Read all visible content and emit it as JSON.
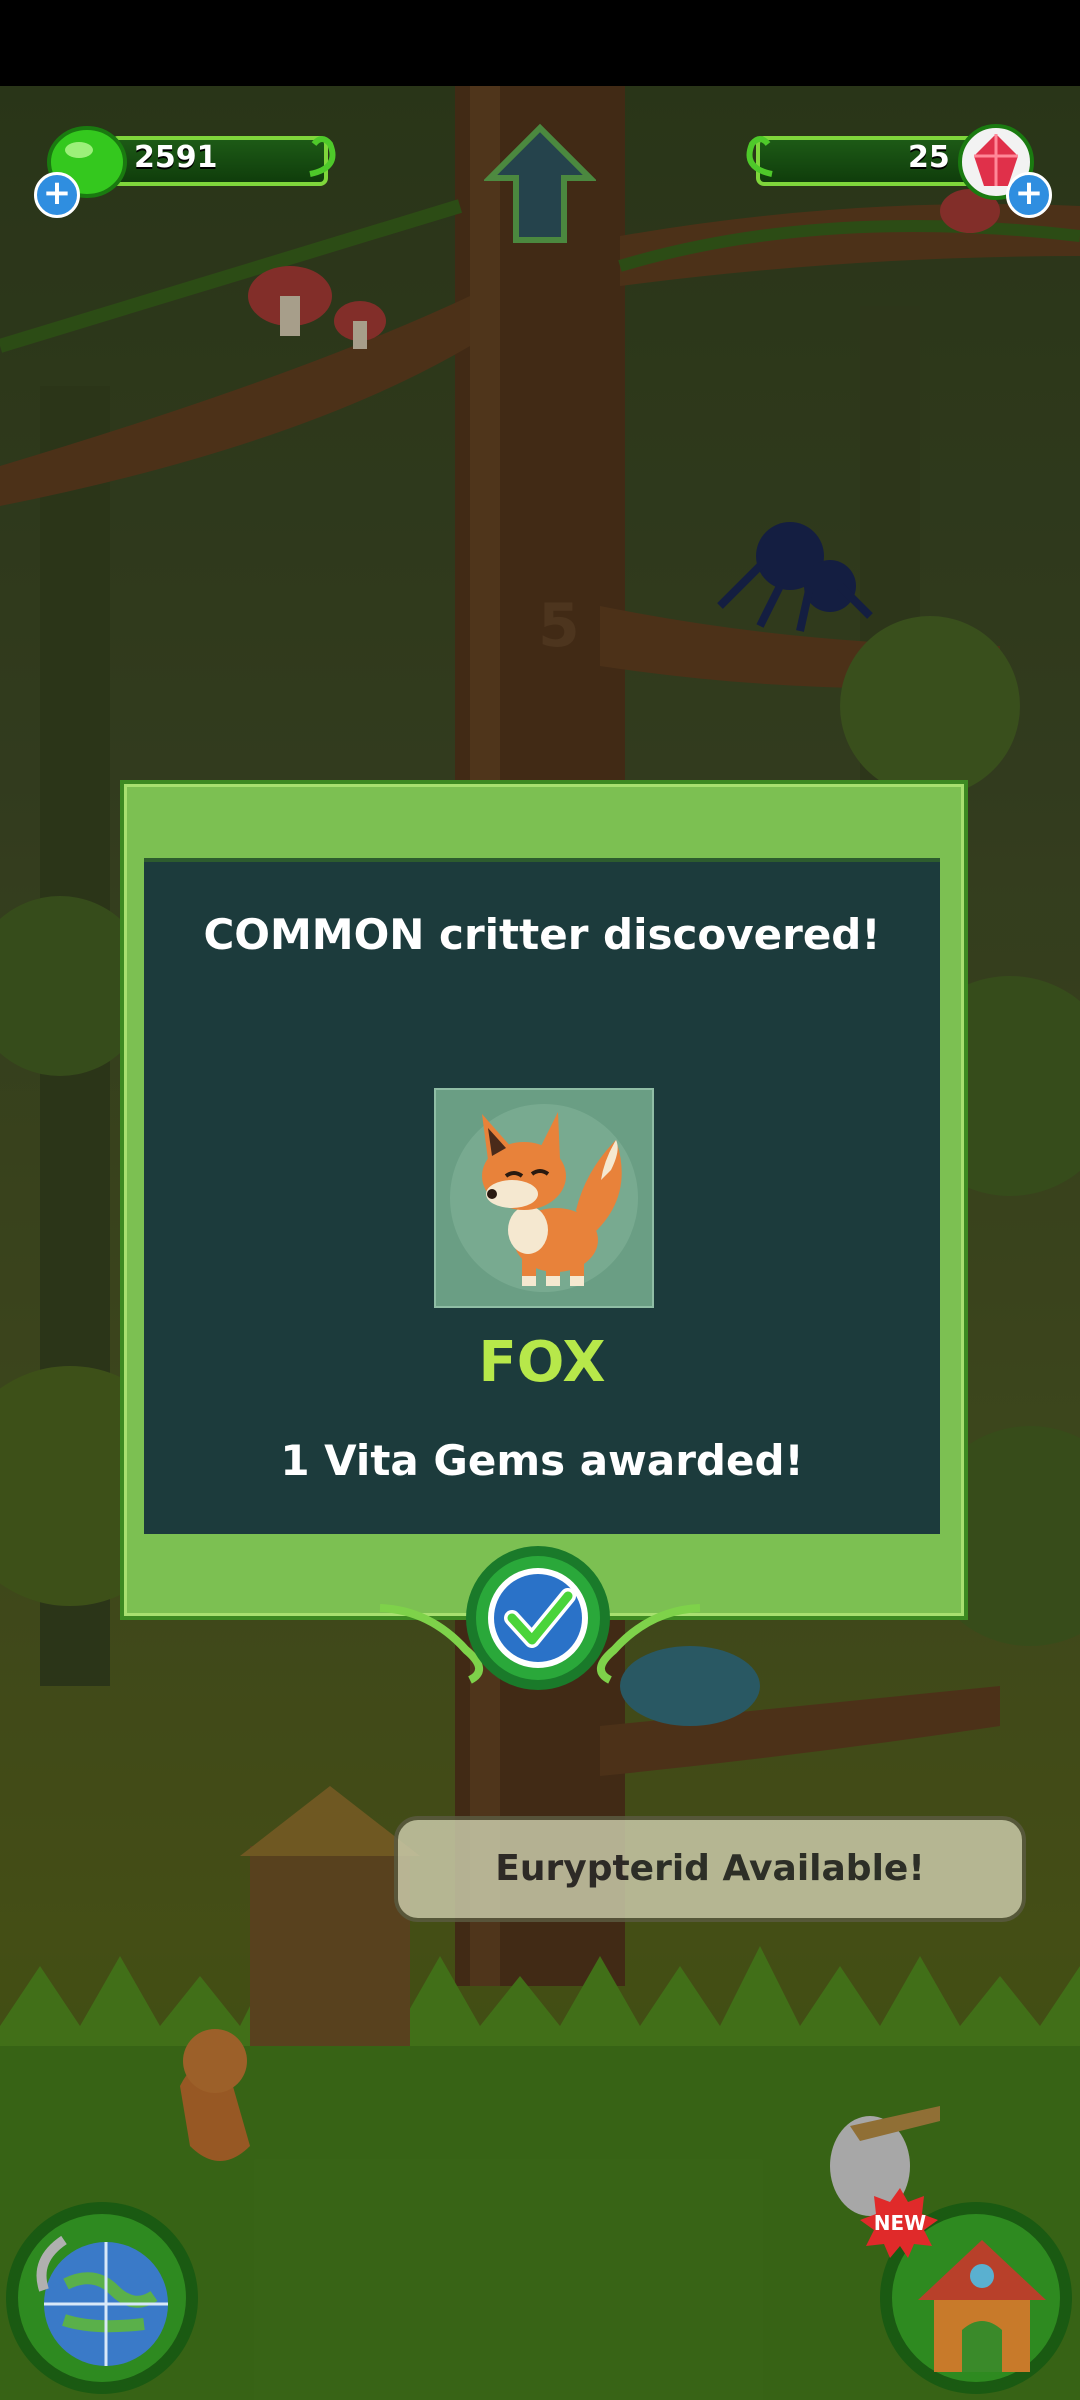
{
  "hud": {
    "green_currency_value": "2591",
    "gem_currency_value": "25",
    "green_currency_icon": "green-gem-icon",
    "gem_icon": "red-gem-icon",
    "home_icon": "up-arrow-home-icon"
  },
  "scene": {
    "tree_level_number": "5"
  },
  "dialog": {
    "title": "COMMON critter discovered!",
    "critter_name": "FOX",
    "award_text": "1 Vita Gems awarded!",
    "confirm_icon": "check-icon"
  },
  "notification": {
    "text": "Eurypterid Available!"
  },
  "bottom": {
    "new_badge": "NEW",
    "map_icon": "globe-icon",
    "house_icon": "house-icon"
  },
  "colors": {
    "dialog_green": "#7cc052",
    "dialog_panel": "#1c3b3c",
    "critter_name": "#b7e84a",
    "hud_border": "#7fd63b"
  }
}
